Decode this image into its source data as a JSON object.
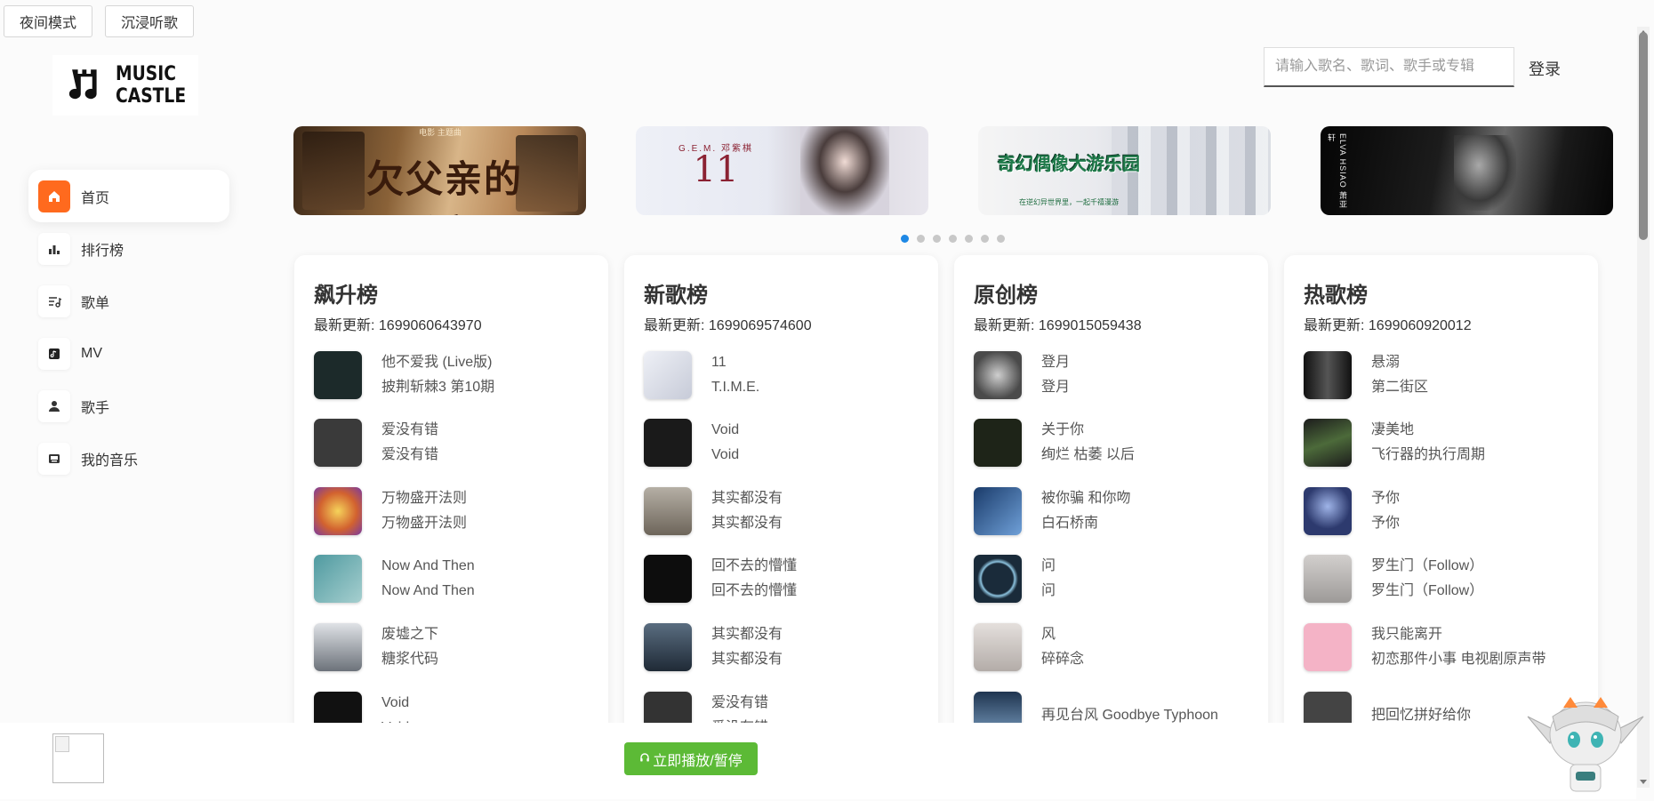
{
  "top_buttons": {
    "night_mode": "夜间模式",
    "immersive": "沉浸听歌"
  },
  "logo": {
    "line1": "MUSIC",
    "line2": "CASTLE"
  },
  "search": {
    "placeholder": "请输入歌名、歌词、歌手或专辑"
  },
  "login": "登录",
  "sidebar": {
    "items": [
      {
        "label": "首页",
        "icon": "home-icon",
        "active": true
      },
      {
        "label": "排行榜",
        "icon": "bar-chart-icon"
      },
      {
        "label": "歌单",
        "icon": "playlist-icon"
      },
      {
        "label": "MV",
        "icon": "mv-icon"
      },
      {
        "label": "歌手",
        "icon": "singer-icon"
      },
      {
        "label": "我的音乐",
        "icon": "my-music-icon"
      }
    ]
  },
  "banners": {
    "items": [
      {
        "title": "欠父亲的话",
        "byline": "电影 主题曲",
        "colors": [
          "#5c3b22",
          "#c49a6c"
        ]
      },
      {
        "title": "11",
        "byline": "G.E.M. 邓紫棋",
        "colors": [
          "#eef0f6",
          "#d9dbe6"
        ]
      },
      {
        "title": "奇幻偶像大游乐园",
        "byline": "在逆幻异世界里，一起千禧漫游",
        "colors": [
          "#f4f4f4",
          "#cfd3dc"
        ]
      },
      {
        "title": "ELVA HSIAO 萧亚轩",
        "byline": "",
        "colors": [
          "#0a0a0a",
          "#555555"
        ]
      }
    ],
    "dot_count": 7,
    "active_dot": 0
  },
  "charts": [
    {
      "title": "飙升榜",
      "update_label": "最新更新:",
      "update_value": "1699060643970",
      "songs": [
        {
          "name": "他不爱我 (Live版)",
          "artist": "披荆斩棘3 第10期",
          "color": "#1c2a2a"
        },
        {
          "name": "爱没有错",
          "artist": "爱没有错",
          "color": "#3a3a3a"
        },
        {
          "name": "万物盛开法则",
          "artist": "万物盛开法则",
          "color": "#c96a3a"
        },
        {
          "name": "Now And Then",
          "artist": "Now And Then",
          "color": "#6aa7a8"
        },
        {
          "name": "废墟之下",
          "artist": "糖浆代码",
          "color": "#9aa0a6"
        },
        {
          "name": "Void",
          "artist": "Void",
          "color": "#111111"
        }
      ]
    },
    {
      "title": "新歌榜",
      "update_label": "最新更新:",
      "update_value": "1699069574600",
      "songs": [
        {
          "name": "11",
          "artist": "T.I.M.E.",
          "color": "#dfe3ec"
        },
        {
          "name": "Void",
          "artist": "Void",
          "color": "#1a1a1a"
        },
        {
          "name": "其实都没有",
          "artist": "其实都没有",
          "color": "#8d8478"
        },
        {
          "name": "回不去的懵懂",
          "artist": "回不去的懵懂",
          "color": "#0d0d0d"
        },
        {
          "name": "其实都没有",
          "artist": "其实都没有",
          "color": "#2c3a4a"
        },
        {
          "name": "爱没有错",
          "artist": "爱没有错",
          "color": "#333333"
        }
      ]
    },
    {
      "title": "原创榜",
      "update_label": "最新更新:",
      "update_value": "1699015059438",
      "songs": [
        {
          "name": "登月",
          "artist": "登月",
          "color": "#6b6b6b"
        },
        {
          "name": "关于你",
          "artist": "绚烂 枯萎 以后",
          "color": "#1e2418"
        },
        {
          "name": "被你骗 和你吻",
          "artist": "白石桥南",
          "color": "#2f5b96"
        },
        {
          "name": "问",
          "artist": "问",
          "color": "#1a2b3a"
        },
        {
          "name": "风",
          "artist": "碎碎念",
          "color": "#cfc9c6"
        },
        {
          "name": "再见台风 Goodbye Typhoon",
          "artist": "",
          "color": "#3d5b7a"
        }
      ]
    },
    {
      "title": "热歌榜",
      "update_label": "最新更新:",
      "update_value": "1699060920012",
      "songs": [
        {
          "name": "悬溺",
          "artist": "第二街区",
          "color": "#222222"
        },
        {
          "name": "凄美地",
          "artist": "飞行器的执行周期",
          "color": "#2f3a2a"
        },
        {
          "name": "予你",
          "artist": "予你",
          "color": "#2d3a6e"
        },
        {
          "name": "罗生门（Follow）",
          "artist": "罗生门（Follow）",
          "color": "#b7b4b2"
        },
        {
          "name": "我只能离开",
          "artist": "初恋那件小事 电视剧原声带",
          "color": "#f4b3c6"
        },
        {
          "name": "把回忆拼好给你",
          "artist": "",
          "color": "#444444"
        }
      ]
    }
  ],
  "player": {
    "play_label": "立即播放/暂停"
  }
}
